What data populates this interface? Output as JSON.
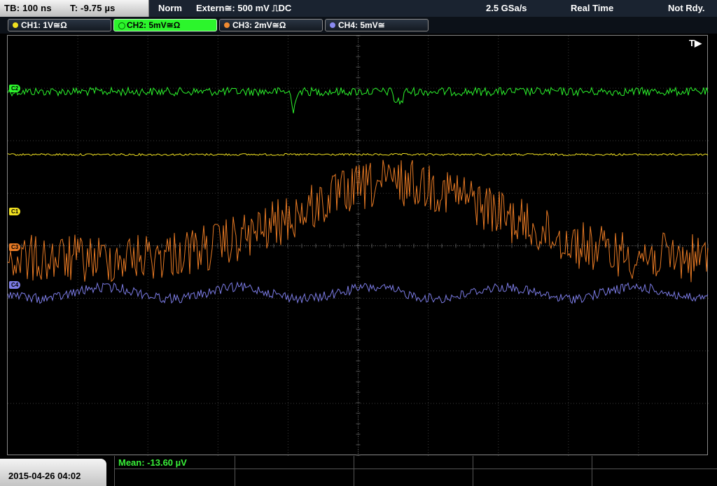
{
  "top": {
    "timebase": "TB: 100 ns",
    "trig_pos": "T: -9.75 µs",
    "mode": "Norm",
    "trigger": "Extern≅: 500 mV ⎍DC",
    "sample_rate": "2.5 GSa/s",
    "acq": "Real Time",
    "status": "Not Rdy."
  },
  "channels": [
    {
      "label": "CH1: 1V≅Ω",
      "color": "#f0e020",
      "active": false
    },
    {
      "label": "CH2: 5mV≅Ω",
      "color": "#2cf52c",
      "active": true
    },
    {
      "label": "CH3: 2mV≅Ω",
      "color": "#f08a30",
      "active": false
    },
    {
      "label": "CH4: 5mV≅",
      "color": "#8a8af0",
      "active": false
    }
  ],
  "trigger_marker": "T▶",
  "markers": {
    "c1": "C1",
    "c2": "C2",
    "c3": "C3",
    "c4": "C4"
  },
  "footer": {
    "datetime": "2015-04-26 04:02",
    "measurement": "Mean: -13.60 µV"
  },
  "trace_colors": {
    "ch1": "#f0e020",
    "ch2": "#2cf52c",
    "ch3": "#e87a24",
    "ch4": "#7c7ce6"
  }
}
